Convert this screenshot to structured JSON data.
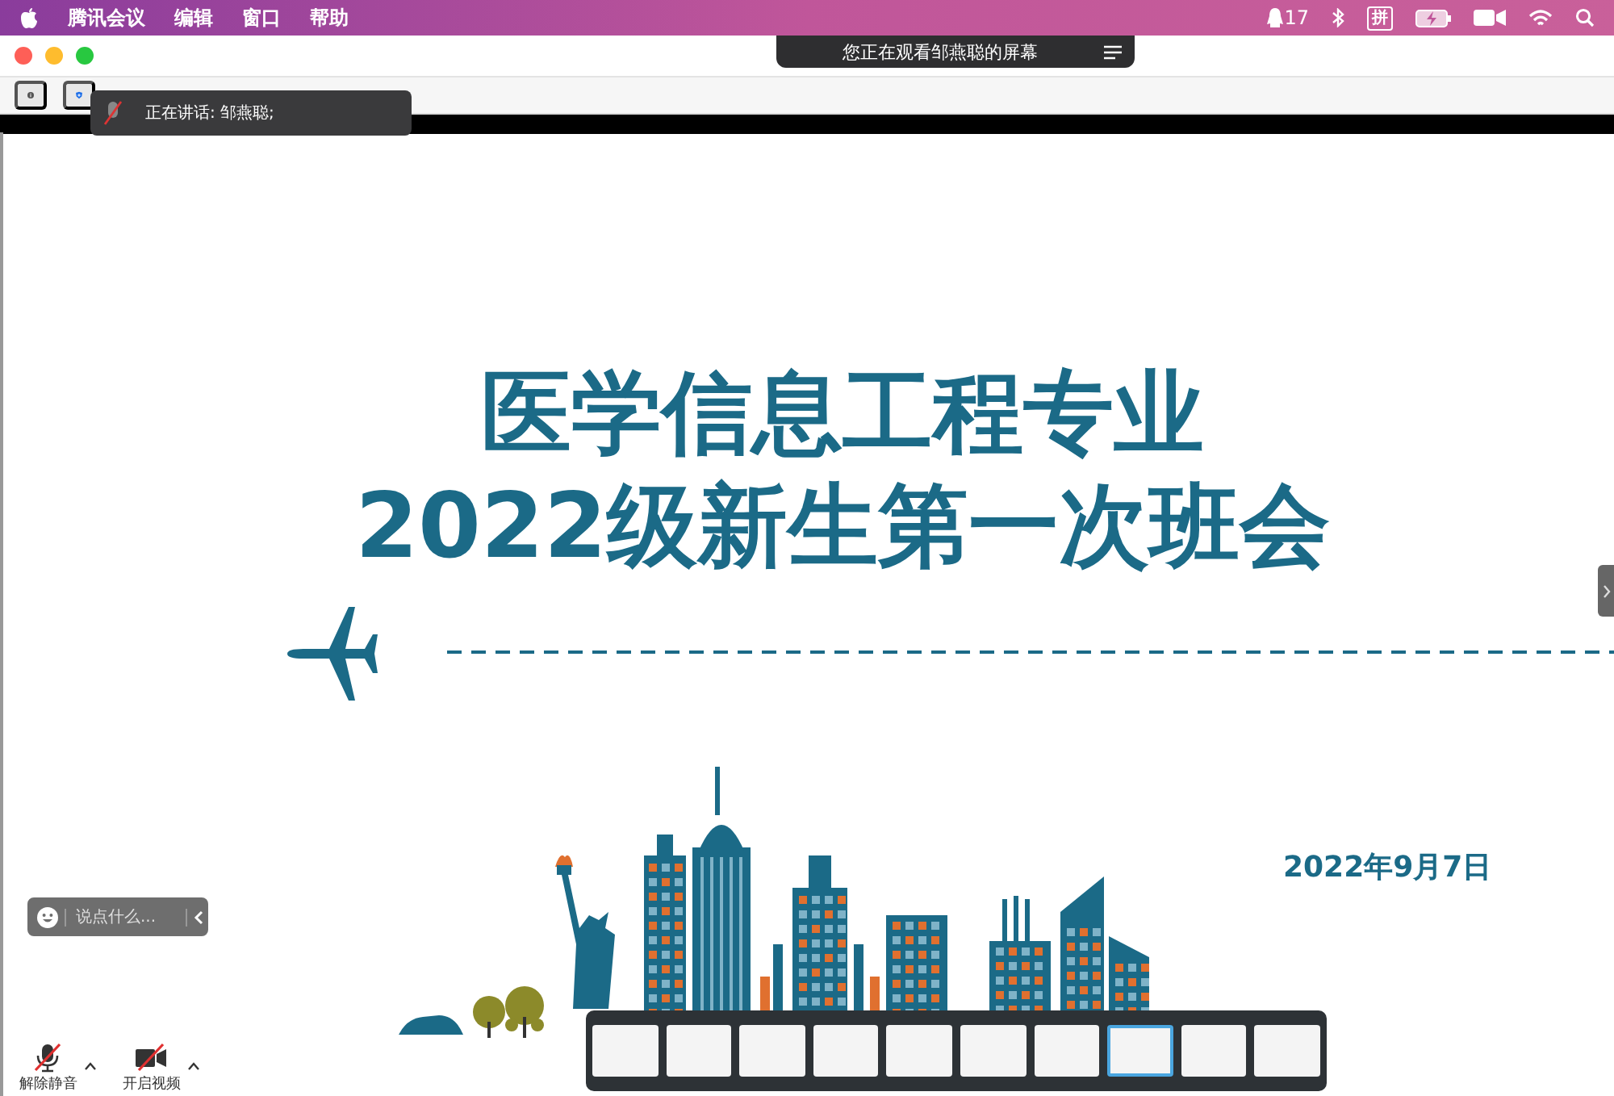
{
  "menubar": {
    "menus": [
      "腾讯会议",
      "编辑",
      "窗口",
      "帮助"
    ],
    "qq_count": "17",
    "input_method": "拼"
  },
  "share_banner": {
    "text": "您正在观看邹燕聪的屏幕"
  },
  "speaker_toast": {
    "text": "正在讲话: 邹燕聪;"
  },
  "slide": {
    "title_lines": [
      "医学信息工程专业",
      "2022级新生第一次班会"
    ],
    "date": "2022年9月7日"
  },
  "chat": {
    "placeholder": "说点什么..."
  },
  "controls": [
    {
      "kind": "mic",
      "label": "解除静音",
      "off": true
    },
    {
      "kind": "camera",
      "label": "开启视频",
      "off": true
    }
  ],
  "thumbnails": [
    {
      "selected": false
    },
    {
      "selected": false
    },
    {
      "selected": false
    },
    {
      "selected": false
    },
    {
      "selected": false
    },
    {
      "selected": false
    },
    {
      "selected": false
    },
    {
      "selected": true
    },
    {
      "selected": false
    },
    {
      "selected": false
    }
  ]
}
